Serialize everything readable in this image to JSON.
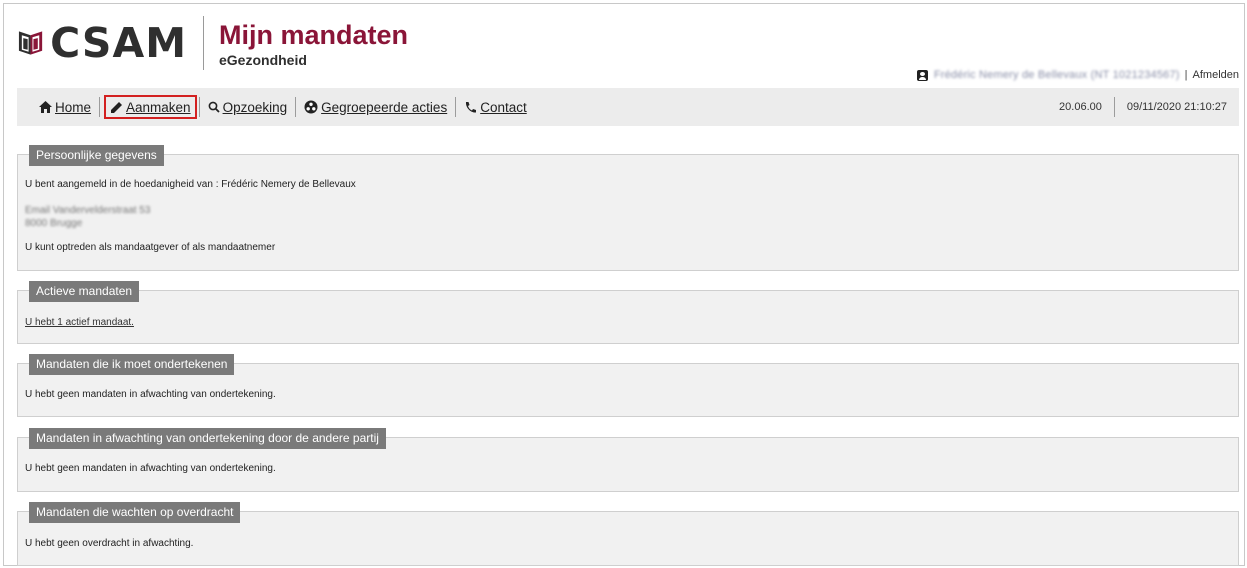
{
  "header": {
    "logo_text": "CSAM",
    "app_title": "Mijn mandaten",
    "app_subtitle": "eGezondheid",
    "user_name": "Frédéric Nemery de Bellevaux (NT 1021234567)",
    "logout_label": "Afmelden",
    "user_separator": "|"
  },
  "nav": {
    "items": [
      {
        "label": "Home",
        "icon": "home-icon"
      },
      {
        "label": "Aanmaken",
        "icon": "pencil-icon"
      },
      {
        "label": "Opzoeking",
        "icon": "search-icon"
      },
      {
        "label": "Gegroepeerde acties",
        "icon": "group-icon"
      },
      {
        "label": "Contact",
        "icon": "phone-icon"
      }
    ],
    "version": "20.06.00",
    "datetime": "09/11/2020 21:10:27"
  },
  "panels": {
    "personal": {
      "title": "Persoonlijke gegevens",
      "line1": "U bent aangemeld in de hoedanigheid van : Frédéric Nemery de Bellevaux",
      "address1": "Email Vandervelderstraat 53",
      "address2": "8000 Brugge",
      "line3": "U kunt optreden als mandaatgever of als mandaatnemer"
    },
    "active": {
      "title": "Actieve mandaten",
      "text": "U hebt 1 actief mandaat."
    },
    "to_sign": {
      "title": "Mandaten die ik moet ondertekenen",
      "text": "U hebt geen mandaten in afwachting van ondertekening."
    },
    "awaiting_other": {
      "title": "Mandaten in afwachting van ondertekening door de andere partij",
      "text": "U hebt geen mandaten in afwachting van ondertekening."
    },
    "awaiting_transfer": {
      "title": "Mandaten die wachten op overdracht",
      "text": "U hebt geen overdracht in afwachting."
    }
  },
  "colors": {
    "brand": "#8a1538",
    "legend_bg": "#7a7a7a",
    "panel_bg": "#f1f1f1",
    "highlight_border": "#d32020"
  }
}
